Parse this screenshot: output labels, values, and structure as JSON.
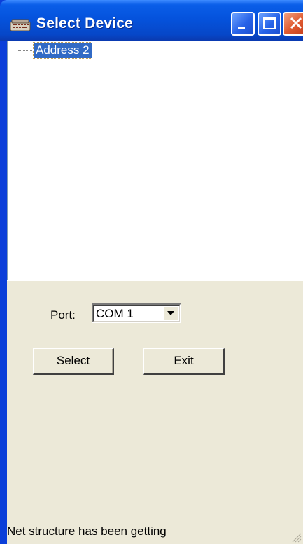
{
  "window": {
    "title": "Select Device",
    "icon": "keyboard-device-icon"
  },
  "titlebar_buttons": {
    "minimize": "minimize-icon",
    "maximize": "maximize-icon",
    "close": "close-icon"
  },
  "tree": {
    "items": [
      {
        "label": "Address 2",
        "selected": true
      }
    ]
  },
  "port": {
    "label": "Port:",
    "value": "COM 1"
  },
  "buttons": {
    "select_label": "Select",
    "exit_label": "Exit"
  },
  "status": {
    "text": "Net structure has been getting"
  },
  "colors": {
    "titlebar": "#0553dd",
    "selection": "#316ac5",
    "dialog_bg": "#ece9d8",
    "close_button": "#e05a30"
  }
}
